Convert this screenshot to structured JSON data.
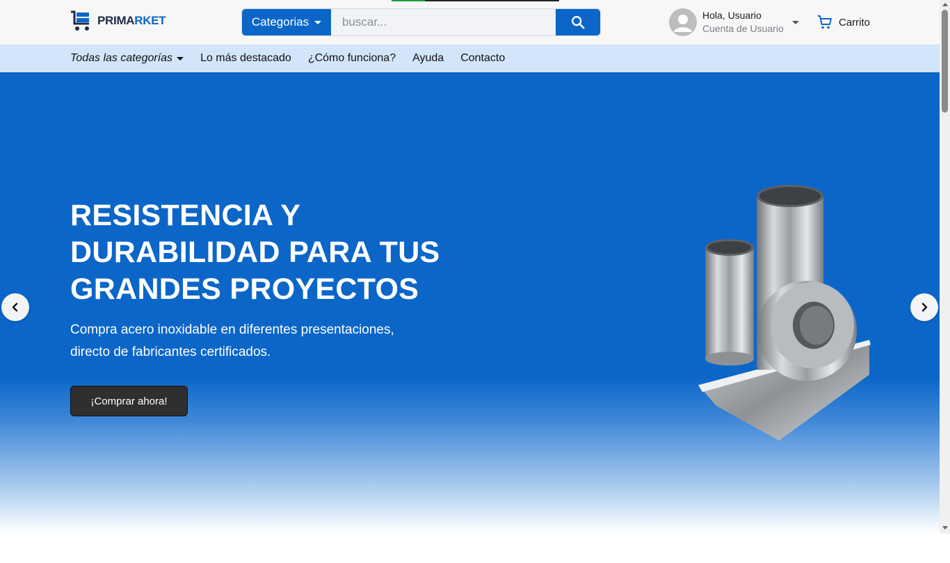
{
  "header": {
    "logo": {
      "part1": "PRIMA",
      "part2": "RKET"
    },
    "search": {
      "category_label": "Categorias",
      "placeholder": "buscar..."
    },
    "account": {
      "greeting": "Hola, Usuario",
      "subtitle": "Cuenta de Usuario"
    },
    "cart": {
      "label": "Carrito"
    },
    "load_progress": 0.2,
    "colors": {
      "brand": "#0b66c8",
      "logo_dark": "#1f2a44",
      "nav_bg": "#d3e5fa"
    }
  },
  "nav": {
    "items": [
      {
        "label": "Todas las categorías",
        "dropdown": true
      },
      {
        "label": "Lo más destacado"
      },
      {
        "label": "¿Cómo funciona?"
      },
      {
        "label": "Ayuda"
      },
      {
        "label": "Contacto"
      }
    ]
  },
  "hero": {
    "title_lines": [
      "RESISTENCIA Y",
      "DURABILIDAD PARA TUS",
      "GRANDES PROYECTOS"
    ],
    "subtitle_lines": [
      "Compra acero inoxidable en diferentes presentaciones,",
      "directo de fabricantes certificados."
    ],
    "cta_label": "¡Comprar ahora!",
    "background": "#0b66c8"
  },
  "icons": {
    "search": "search-icon",
    "avatar": "user-avatar-icon",
    "cart": "shopping-cart-icon",
    "prev": "chevron-left-icon",
    "next": "chevron-right-icon"
  }
}
